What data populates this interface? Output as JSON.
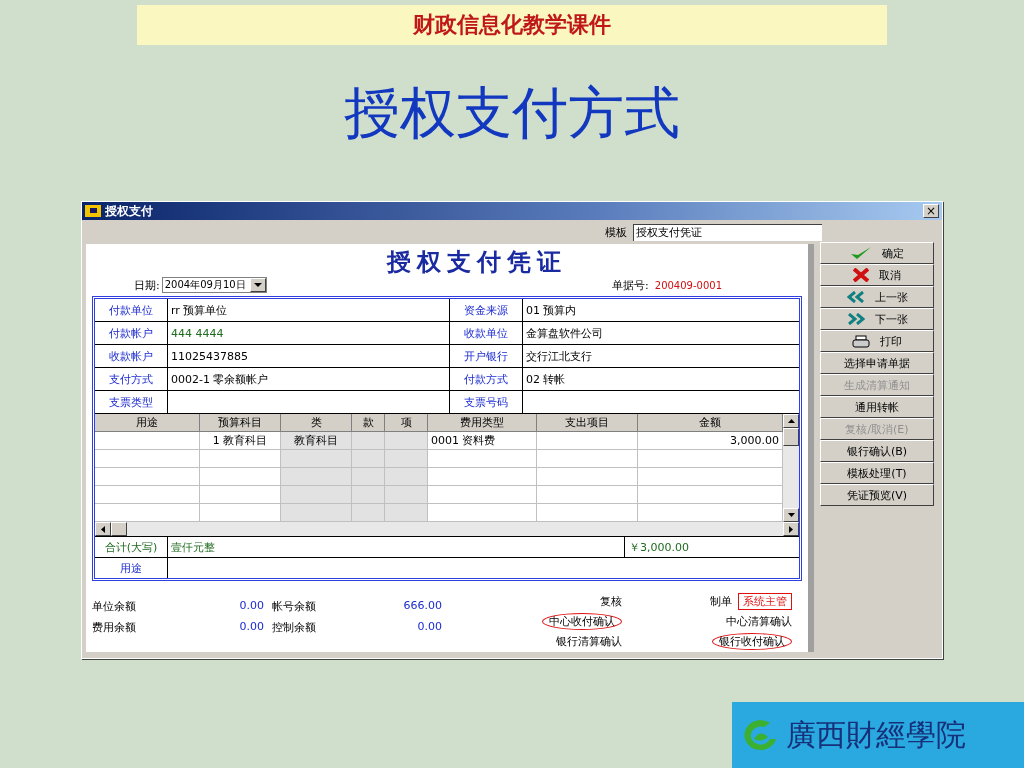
{
  "slide": {
    "banner": "财政信息化教学课件",
    "title": "授权支付方式",
    "logo_text": "廣西財經學院"
  },
  "window": {
    "title": "授权支付",
    "close": "×"
  },
  "template": {
    "label": "模板",
    "value": "授权支付凭证"
  },
  "voucher": {
    "heading": "授权支付凭证",
    "date_label": "日期:",
    "date": "2004年09月10日",
    "number_label": "单据号:",
    "number": "200409-0001"
  },
  "fields": [
    {
      "label": "付款单位",
      "value": "rr 预算单位",
      "label2": "资金来源",
      "value2": "01 预算内"
    },
    {
      "label": "付款帐户",
      "value": "444 4444",
      "color": "#1f6b1f",
      "label2": "收款单位",
      "value2": "金算盘软件公司"
    },
    {
      "label": "收款帐户",
      "value": "11025437885",
      "label2": "开户银行",
      "value2": "交行江北支行"
    },
    {
      "label": "支付方式",
      "value": "0002-1 零余额帐户",
      "label2": "付款方式",
      "value2": "02 转帐"
    },
    {
      "label": "支票类型",
      "label2": "支票号码"
    }
  ],
  "table": {
    "columns": [
      {
        "name": "用途",
        "shaded": false
      },
      {
        "name": "预算科目",
        "shaded": false
      },
      {
        "name": "类",
        "shaded": true
      },
      {
        "name": "款",
        "shaded": true
      },
      {
        "name": "项",
        "shaded": true
      },
      {
        "name": "费用类型",
        "shaded": false
      },
      {
        "name": "支出项目",
        "shaded": false
      },
      {
        "name": "金额",
        "shaded": false
      }
    ],
    "rows": [
      {
        "cells": [
          "",
          "1 教育科目",
          "教育科目",
          "",
          "",
          "0001 资料费",
          "",
          "3,000.00"
        ]
      },
      {
        "cells": [
          "",
          "",
          "",
          "",
          "",
          "",
          "",
          ""
        ]
      },
      {
        "cells": [
          "",
          "",
          "",
          "",
          "",
          "",
          "",
          ""
        ]
      },
      {
        "cells": [
          "",
          "",
          "",
          "",
          "",
          "",
          "",
          ""
        ]
      },
      {
        "cells": [
          "",
          "",
          "",
          "",
          "",
          "",
          "",
          ""
        ]
      }
    ]
  },
  "total": {
    "label": "合计(大写)",
    "words": "壹仟元整",
    "amount": "￥3,000.00"
  },
  "purpose": {
    "label": "用途"
  },
  "balances": [
    {
      "label": "单位余额",
      "value": "0.00",
      "label2": "帐号余额",
      "value2": "666.00"
    },
    {
      "label": "费用余额",
      "value": "0.00",
      "label2": "控制余额",
      "value2": "0.00"
    }
  ],
  "signatures": [
    {
      "label": "复核",
      "circled": false
    },
    {
      "label": "制单",
      "value": "系统主管",
      "circled": false
    },
    {
      "label": "中心收付确认",
      "circled": true
    },
    {
      "label": "中心清算确认",
      "circled": false
    },
    {
      "label": "银行清算确认",
      "circled": false
    },
    {
      "label": "银行收付确认",
      "circled": true
    }
  ],
  "buttons": [
    {
      "label": "确定",
      "kind": "check",
      "disabled": false
    },
    {
      "label": "取消",
      "kind": "cross",
      "disabled": false
    },
    {
      "label": "上一张",
      "kind": "prev",
      "disabled": false
    },
    {
      "label": "下一张",
      "kind": "next",
      "disabled": false
    },
    {
      "label": "打印",
      "kind": "print",
      "disabled": false
    },
    {
      "label": "选择申请单据",
      "kind": "text",
      "disabled": false
    },
    {
      "label": "生成清算通知",
      "kind": "text",
      "disabled": true
    },
    {
      "label": "通用转帐",
      "kind": "text",
      "disabled": false
    },
    {
      "label": "复核/取消(E)",
      "kind": "text",
      "disabled": true
    },
    {
      "label": "银行确认(B)",
      "kind": "text",
      "disabled": false
    },
    {
      "label": "模板处理(T)",
      "kind": "text",
      "disabled": false
    },
    {
      "label": "凭证预览(V)",
      "kind": "text",
      "disabled": false
    }
  ]
}
